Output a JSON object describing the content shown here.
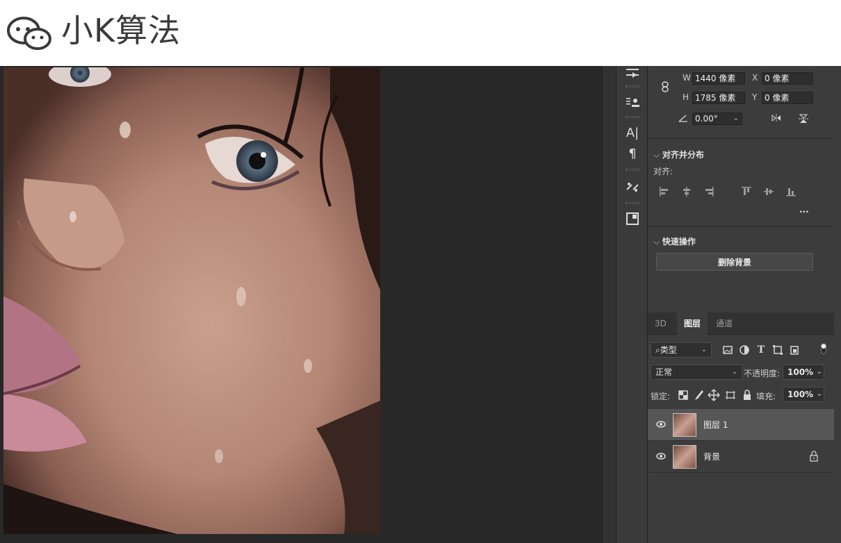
{
  "watermark": {
    "text": "小K算法",
    "icon": "wechat-icon"
  },
  "transform": {
    "w_label": "W",
    "w_value": "1440 像素",
    "x_label": "X",
    "x_value": "0 像素",
    "h_label": "H",
    "h_value": "1785 像素",
    "y_label": "Y",
    "y_value": "0 像素",
    "angle_value": "0.00°"
  },
  "align": {
    "header": "对齐并分布",
    "sub_label": "对齐:",
    "more": "···"
  },
  "quick_actions": {
    "header": "快速操作",
    "remove_bg_label": "删除背景"
  },
  "tabs": [
    {
      "label": "3D",
      "active": false
    },
    {
      "label": "图层",
      "active": true
    },
    {
      "label": "通道",
      "active": false
    }
  ],
  "layers_panel": {
    "filter_label": "类型",
    "blend_mode": "正常",
    "opacity_label": "不透明度:",
    "opacity_value": "100%",
    "lock_label": "锁定:",
    "fill_label": "填充:",
    "fill_value": "100%",
    "layers": [
      {
        "name": "图层 1",
        "selected": true,
        "locked": false
      },
      {
        "name": "背景",
        "selected": false,
        "locked": true
      }
    ]
  },
  "tools": {
    "text_tool": "A|",
    "paragraph_tool": "¶"
  }
}
